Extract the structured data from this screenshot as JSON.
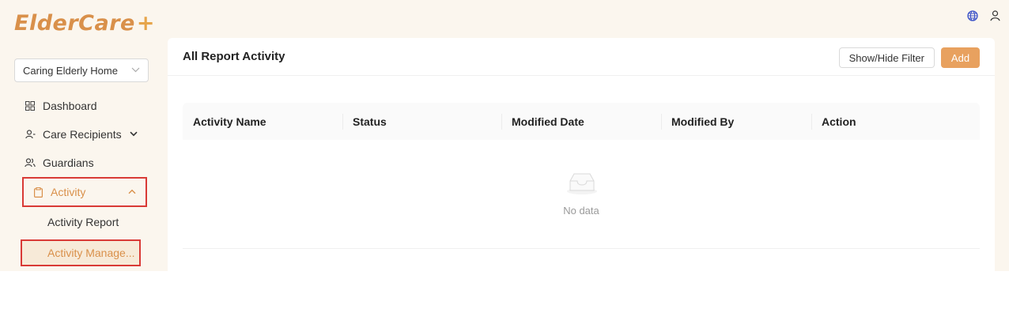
{
  "brand": {
    "name": "ElderCare",
    "plus": "+"
  },
  "org_select": {
    "value": "Caring Elderly Home"
  },
  "nav": {
    "dashboard": "Dashboard",
    "care_recipients": "Care Recipients",
    "guardians": "Guardians",
    "activity": "Activity",
    "activity_report": "Activity Report",
    "activity_manage": "Activity Manage..."
  },
  "header_icons": [
    "globe-icon",
    "user-icon"
  ],
  "page": {
    "title": "All Report Activity",
    "filter_button": "Show/Hide Filter",
    "add_button": "Add"
  },
  "table": {
    "columns": [
      "Activity Name",
      "Status",
      "Modified Date",
      "Modified By",
      "Action"
    ],
    "rows": [],
    "empty_text": "No data"
  },
  "colors": {
    "accent": "#d9904a",
    "button_primary": "#e8a15f",
    "highlight_border": "#d93a36",
    "sidebar_bg": "#fbf6ee"
  }
}
